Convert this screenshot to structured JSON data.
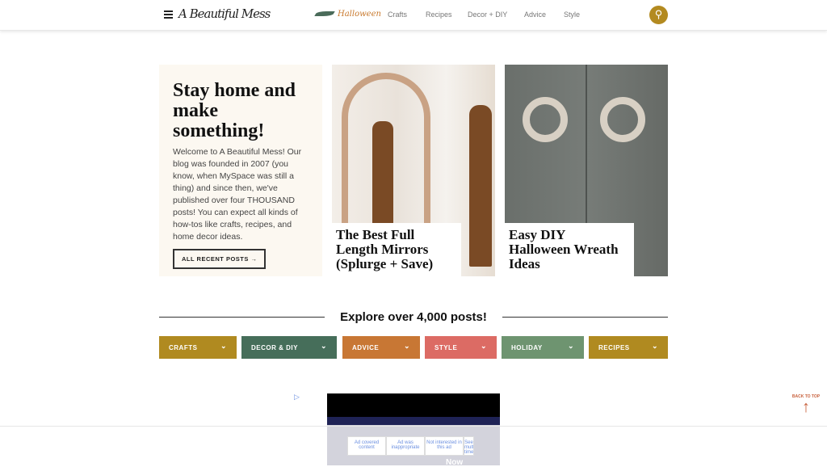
{
  "header": {
    "logo": "A Beautiful Mess",
    "featured": "Halloween",
    "nav": [
      "Crafts",
      "Recipes",
      "Decor + DIY",
      "Advice",
      "Style"
    ]
  },
  "intro": {
    "title": "Stay home and make something!",
    "text": "Welcome to A Beautiful Mess! Our blog was founded in 2007 (you know, when MySpace was still a thing) and since then, we've published over four THOUSAND posts! You can expect all kinds of how-tos like crafts, recipes, and home decor ideas.",
    "button": "ALL RECENT POSTS →"
  },
  "cards": [
    {
      "title": "The Best Full Length Mirrors (Splurge + Save)"
    },
    {
      "title": "Easy DIY Halloween Wreath Ideas"
    }
  ],
  "explore": {
    "heading": "Explore over 4,000 posts!",
    "categories": [
      {
        "label": "CRAFTS",
        "color": "#b08a20"
      },
      {
        "label": "DECOR & DIY",
        "color": "#466e5a"
      },
      {
        "label": "ADVICE",
        "color": "#c87734"
      },
      {
        "label": "STYLE",
        "color": "#dc6b64"
      },
      {
        "label": "HOLIDAY",
        "color": "#6e9470"
      },
      {
        "label": "RECIPES",
        "color": "#b08a20"
      }
    ]
  },
  "ad": {
    "options": [
      "Ad covered content",
      "Ad was inappropriate",
      "Not interested in this ad",
      "See multiple times"
    ],
    "cta": "Now"
  },
  "back_to_top": "BACK TO TOP"
}
